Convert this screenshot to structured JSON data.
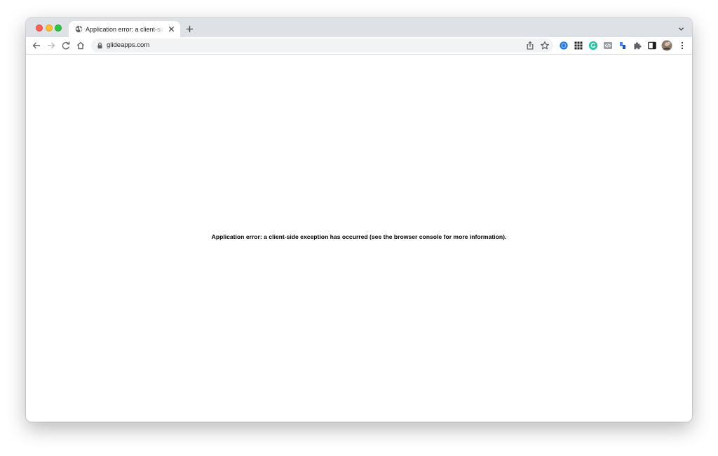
{
  "browser": {
    "tab": {
      "title": "Application error: a client-side exception has occurred",
      "favicon": "globe-icon"
    },
    "address_bar": {
      "url": "glideapps.com",
      "security": "lock-icon"
    },
    "extensions": [
      "blue-circle-extension-icon",
      "grid-extension-icon",
      "grammarly-extension-icon",
      "code-extension-icon",
      "flag-extension-icon",
      "puzzle-icon"
    ],
    "colors": {
      "tabstrip": "#dee1e6",
      "omnibox": "#f1f3f4",
      "icon": "#5f6368",
      "close_dot": "#fe5f57",
      "minimize_dot": "#febc2e",
      "maximize_dot": "#28c840"
    }
  },
  "page": {
    "error_message": "Application error: a client-side exception has occurred (see the browser console for more information)."
  }
}
